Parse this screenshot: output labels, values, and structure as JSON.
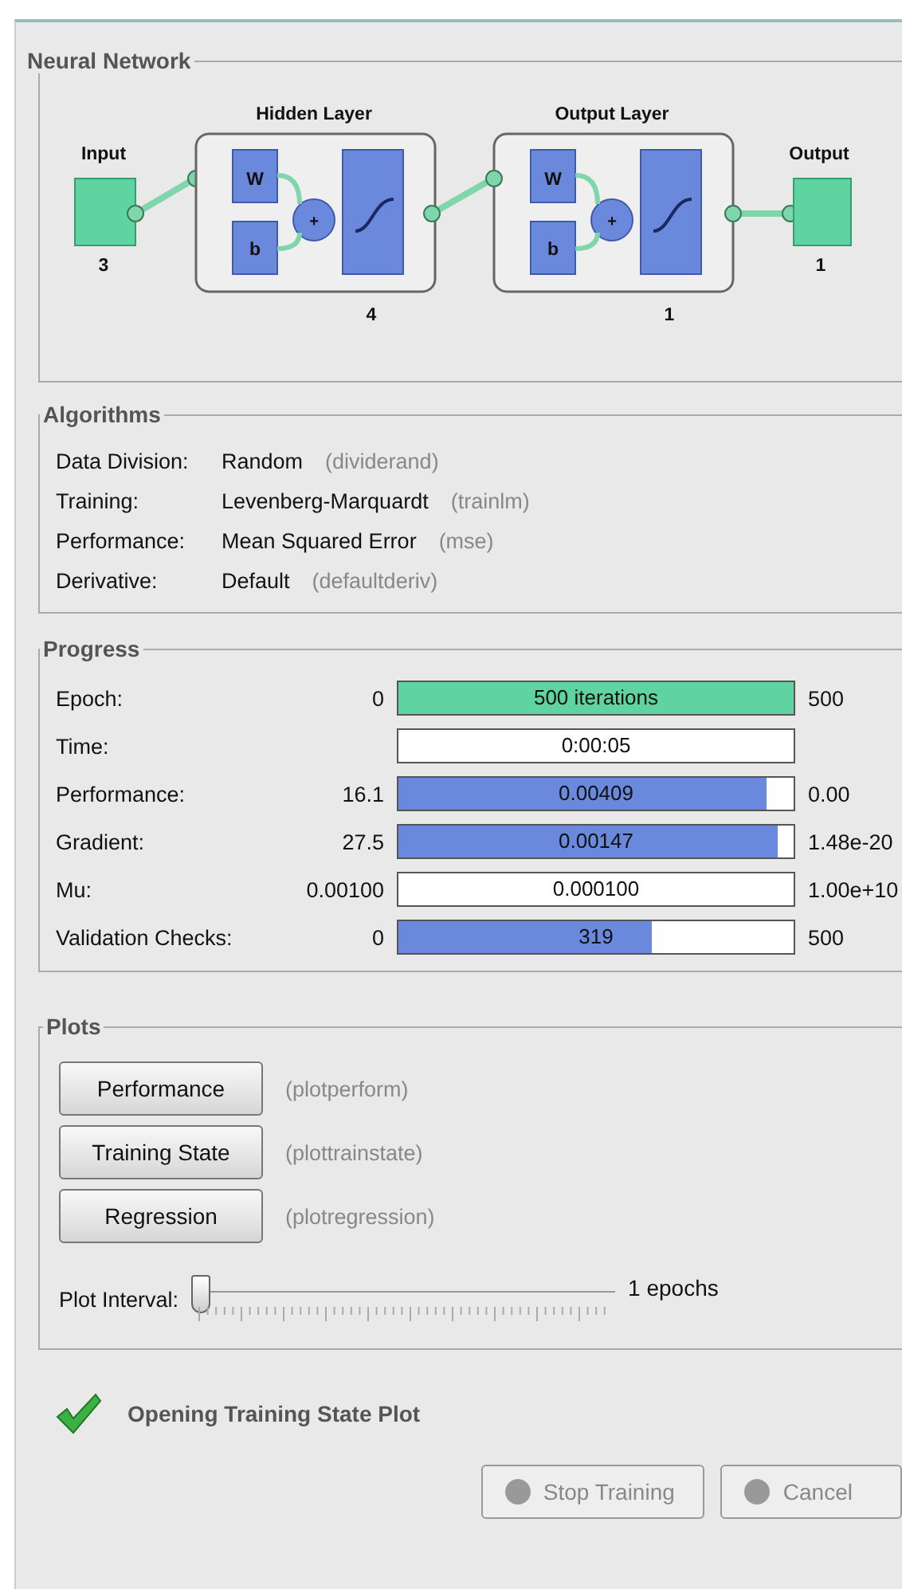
{
  "network": {
    "title": "Neural Network",
    "input": {
      "label": "Input",
      "size": "3"
    },
    "layers": [
      {
        "title": "Hidden Layer",
        "weight": "W",
        "bias": "b",
        "sum": "+",
        "size": "4"
      },
      {
        "title": "Output Layer",
        "weight": "W",
        "bias": "b",
        "sum": "+",
        "size": "1"
      }
    ],
    "output": {
      "label": "Output",
      "size": "1"
    }
  },
  "algorithms": {
    "title": "Algorithms",
    "rows": [
      {
        "label": "Data Division:",
        "value": "Random",
        "function": "(dividerand)"
      },
      {
        "label": "Training:",
        "value": "Levenberg-Marquardt",
        "function": "(trainlm)"
      },
      {
        "label": "Performance:",
        "value": "Mean Squared Error",
        "function": "(mse)"
      },
      {
        "label": "Derivative:",
        "value": "Default",
        "function": "(defaultderiv)"
      }
    ]
  },
  "progress": {
    "title": "Progress",
    "rows": [
      {
        "label": "Epoch:",
        "start": "0",
        "reading": "500 iterations",
        "end": "500",
        "level": 1,
        "color": "#5fd3a0"
      },
      {
        "label": "Time:",
        "reading": "0:00:05"
      },
      {
        "label": "Performance:",
        "start": "16.1",
        "reading": "0.00409",
        "end": "0.00",
        "level": 0.93,
        "color": "#6b89dc"
      },
      {
        "label": "Gradient:",
        "start": "27.5",
        "reading": "0.00147",
        "end": "1.48e-20",
        "level": 0.96,
        "color": "#6b89dc"
      },
      {
        "label": "Mu:",
        "start": "0.00100",
        "reading": "0.000100",
        "end": "1.00e+10"
      },
      {
        "label": "Validation Checks:",
        "start": "0",
        "reading": "319",
        "end": "500",
        "level": 0.64,
        "color": "#6b89dc"
      }
    ]
  },
  "plots": {
    "title": "Plots",
    "buttons": [
      {
        "label": "Performance",
        "function": "(plotperform)"
      },
      {
        "label": "Training State",
        "function": "(plottrainstate)"
      },
      {
        "label": "Regression",
        "function": "(plotregression)"
      }
    ],
    "interval": {
      "label": "Plot Interval:",
      "level": 0,
      "reading": "1 epochs"
    }
  },
  "status": {
    "message": "Opening Training State Plot"
  },
  "buttons": [
    {
      "label": "Stop Training",
      "disabled": true
    },
    {
      "label": "Cancel",
      "disabled": true
    }
  ]
}
